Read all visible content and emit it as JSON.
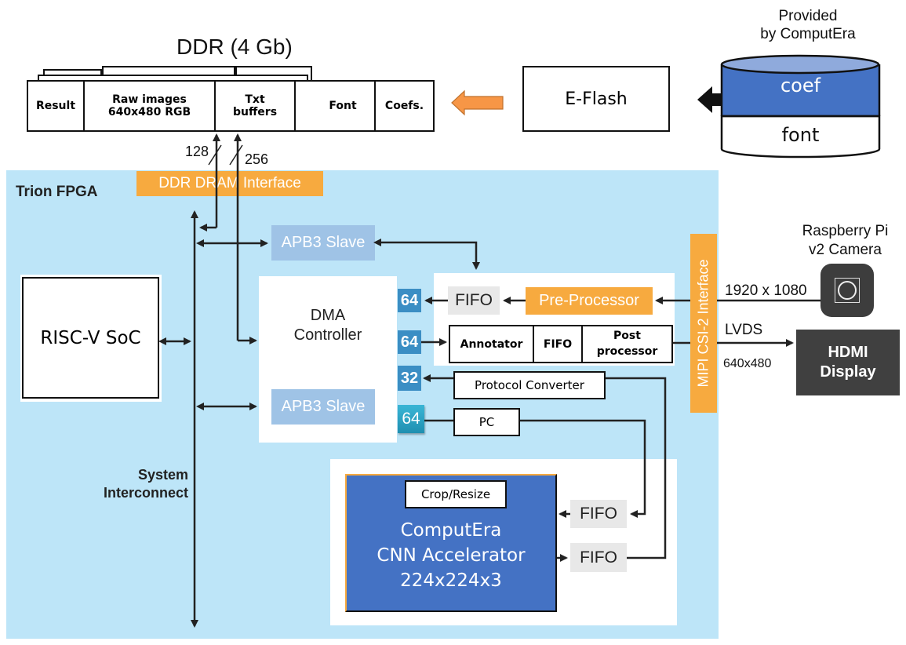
{
  "ddr": {
    "title": "DDR (4 Gb)",
    "segments": [
      "Result",
      "Raw images\n640x480 RGB",
      "Txt\nbuffers",
      "Font",
      "Coefs."
    ],
    "bus_widths": [
      "128",
      "256"
    ]
  },
  "eflash": {
    "label": "E-Flash"
  },
  "storage": {
    "caption": "Provided\nby ComputEra",
    "top_label": "coef",
    "bottom_label": "font"
  },
  "fpga": {
    "title": "Trion FPGA",
    "ddr_interface": "DDR DRAM Interface",
    "system_interconnect": "System\nInterconnect",
    "riscv": "RISC-V SoC",
    "apb3_top": "APB3 Slave",
    "apb3_bottom": "APB3 Slave",
    "dma": "DMA\nController",
    "ports": [
      "64",
      "64",
      "32",
      "64"
    ],
    "fifo_pre": "FIFO",
    "pre_processor": "Pre-Processor",
    "post_chain": [
      "Annotator",
      "FIFO",
      "Post\nprocessor"
    ],
    "protocol_converter": "Protocol Converter",
    "pc": "PC",
    "cnn": {
      "crop": "Crop/Resize",
      "label": "ComputEra\nCNN Accelerator\n224x224x3"
    },
    "cnn_fifo_in": "FIFO",
    "cnn_fifo_out": "FIFO",
    "mipi": "MIPI CSI-2 Interface"
  },
  "camera": {
    "label": "Raspberry Pi\nv2 Camera",
    "resolution": "1920 x 1080"
  },
  "display": {
    "label": "HDMI\nDisplay",
    "link": "LVDS",
    "resolution": "640x480"
  },
  "colors": {
    "fpga_bg": "#bde5f8",
    "orange": "#f7aa3f",
    "port_blue": "#3b8ec4",
    "cnn_blue": "#4472c4",
    "display_gray": "#404040"
  }
}
